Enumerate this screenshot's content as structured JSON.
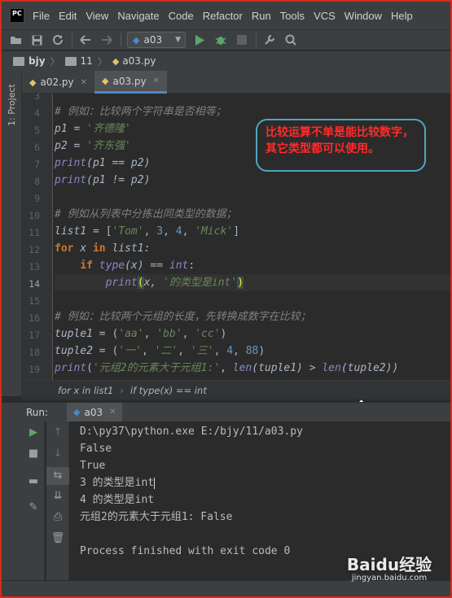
{
  "menubar": {
    "logo": "PC",
    "items": [
      "File",
      "Edit",
      "View",
      "Navigate",
      "Code",
      "Refactor",
      "Run",
      "Tools",
      "VCS",
      "Window",
      "Help"
    ]
  },
  "toolbar": {
    "run_config": "a03"
  },
  "navbar": {
    "crumbs": [
      "bjy",
      "11",
      "a03.py"
    ]
  },
  "left_strip": {
    "project_label": "1: Project"
  },
  "tabs": [
    {
      "label": "a02.py",
      "active": false
    },
    {
      "label": "a03.py",
      "active": true
    }
  ],
  "editor": {
    "current_line": 14,
    "line_numbers": [
      "3",
      "4",
      "5",
      "6",
      "7",
      "8",
      "9",
      "10",
      "11",
      "12",
      "13",
      "14",
      "15",
      "16",
      "17",
      "18",
      "19"
    ],
    "lines": {
      "l4_comment": "# 例如：比较两个字符串是否相等；",
      "l5": {
        "var": "p1",
        "eq": " = ",
        "str": "'齐德隆'"
      },
      "l6": {
        "var": "p2",
        "eq": " = ",
        "str": "'齐东强'"
      },
      "l7": {
        "fn": "print",
        "args": "(p1 == p2)"
      },
      "l8": {
        "fn": "print",
        "args": "(p1 != p2)"
      },
      "l10_comment": "# 例如从列表中分拣出同类型的数据；",
      "l11": {
        "var": "list1",
        "eq": " = [",
        "s1": "'Tom'",
        "c1": ", ",
        "n1": "3",
        "c2": ", ",
        "n2": "4",
        "c3": ", ",
        "s2": "'Mick'",
        "end": "]"
      },
      "l12": {
        "kw_for": "for",
        "x": " x ",
        "kw_in": "in",
        "rest": " list1:"
      },
      "l13": {
        "kw_if": "if",
        "fn": " type",
        "args": "(x) == ",
        "bi": "int",
        "colon": ":"
      },
      "l14": {
        "fn": "print",
        "open": "(",
        "x": "x, ",
        "str": "'的类型是int'",
        "close": ")"
      },
      "l16_comment": "# 例如：比较两个元组的长度，先转换成数字在比较；",
      "l17": {
        "var": "tuple1",
        "eq": " = (",
        "s1": "'aa'",
        "c1": ", ",
        "s2": "'bb'",
        "c2": ", ",
        "s3": "'cc'",
        "end": ")"
      },
      "l18": {
        "var": "tuple2",
        "eq": " = (",
        "s1": "'一'",
        "c1": ", ",
        "s2": "'二'",
        "c2": ", ",
        "s3": "'三'",
        "c3": ", ",
        "n1": "4",
        "c4": ", ",
        "n2": "88",
        "end": ")"
      },
      "l19": {
        "fn": "print",
        "open": "(",
        "str": "'元组2的元素大于元组1:'",
        "c1": ", ",
        "len1": "len",
        "a1": "(tuple1) > ",
        "len2": "len",
        "a2": "(tuple2))"
      }
    },
    "callout": "比较运算不单是能比较数字，其它类型都可以使用。"
  },
  "editor_breadcrumb": [
    "for x in list1",
    "if type(x) == int"
  ],
  "run_panel": {
    "label": "Run:",
    "tab": "a03",
    "output": [
      "D:\\py37\\python.exe E:/bjy/11/a03.py",
      "False",
      "True",
      "3 的类型是int",
      "4 的类型是int",
      "元组2的元素大于元组1: False",
      "",
      "Process finished with exit code 0"
    ]
  },
  "watermark": {
    "brand": "Baidu经验",
    "url": "jingyan.baidu.com"
  },
  "colors": {
    "frame_border": "#d9291d",
    "callout_text": "#ff2b2b",
    "callout_border": "#4ea7bd",
    "comment": "#808080",
    "string": "#6a8759",
    "keyword": "#cc7832",
    "number": "#6897bb",
    "builtin": "#8888c6",
    "active_tab_underline": "#4a88c7"
  }
}
